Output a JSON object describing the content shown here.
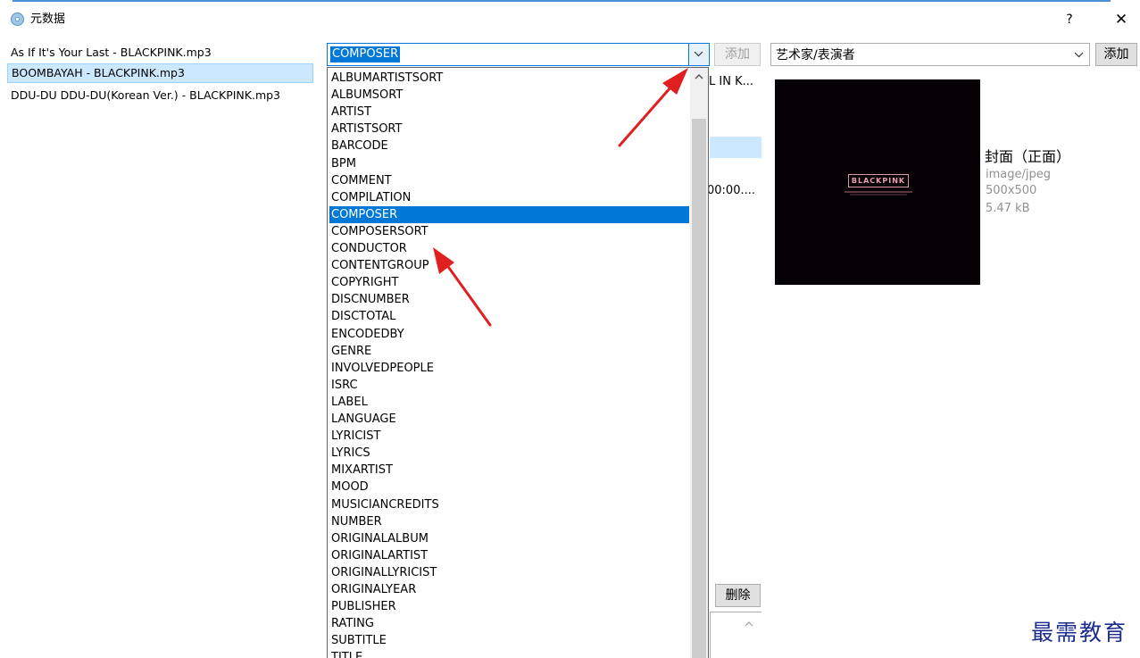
{
  "window": {
    "title": "元数据",
    "help_label": "?",
    "close_label": "✕"
  },
  "files": [
    {
      "name": "As If It's Your Last - BLACKPINK.mp3",
      "selected": false
    },
    {
      "name": "BOOMBAYAH - BLACKPINK.mp3",
      "selected": true
    },
    {
      "name": "DDU-DU DDU-DU(Korean Ver.) - BLACKPINK.mp3",
      "selected": false
    }
  ],
  "field_combo": {
    "value": "COMPOSER",
    "add_label": "添加",
    "options": [
      "ALBUMARTISTSORT",
      "ALBUMSORT",
      "ARTIST",
      "ARTISTSORT",
      "BARCODE",
      "BPM",
      "COMMENT",
      "COMPILATION",
      "COMPOSER",
      "COMPOSERSORT",
      "CONDUCTOR",
      "CONTENTGROUP",
      "COPYRIGHT",
      "DISCNUMBER",
      "DISCTOTAL",
      "ENCODEDBY",
      "GENRE",
      "INVOLVEDPEOPLE",
      "ISRC",
      "LABEL",
      "LANGUAGE",
      "LYRICIST",
      "LYRICS",
      "MIXARTIST",
      "MOOD",
      "MUSICIANCREDITS",
      "NUMBER",
      "ORIGINALALBUM",
      "ORIGINALARTIST",
      "ORIGINALLYRICIST",
      "ORIGINALYEAR",
      "PUBLISHER",
      "RATING",
      "SUBTITLE",
      "TITLE"
    ],
    "selected_option": "COMPOSER"
  },
  "behind": {
    "text1": "L IN K...",
    "text2": "00:00....",
    "delete_label": "删除"
  },
  "picture_panel": {
    "type_value": "艺术家/表演者",
    "add_label": "添加",
    "cover_logo_text": "BLACKPINK",
    "cover_title": "封面（正面）",
    "mime": "image/jpeg",
    "dimensions": "500x500",
    "size": "5.47 kB"
  },
  "watermark": "最需教育",
  "colors": {
    "accent": "#0078d7",
    "selection_light": "#cce8ff",
    "annotation_arrow": "#e02020",
    "watermark": "#1c2d8f"
  }
}
